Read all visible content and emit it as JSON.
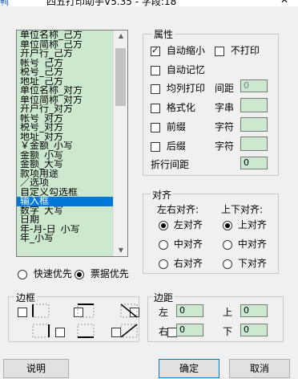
{
  "window": {
    "title": "四五打印助手V5.35 - 字段:18",
    "close_glyph": "✕",
    "icon_glyph": "鸭"
  },
  "list": {
    "items": [
      "单位名称_己方",
      "单位简称_己方",
      "开户行_己方",
      "帐号_己方",
      "税号_己方",
      "地址_己方",
      "单位名称_对方",
      "单位简称_对方",
      "开户行_对方",
      "帐号_对方",
      "税号_对方",
      "地址_对方",
      "￥金额_小写",
      "金额_小写",
      "金额_大写",
      "款项用途",
      "／选项",
      "自定义勾选框",
      "输入框",
      "数字_大写",
      "日期",
      "年-月-日_小写",
      "年_小写"
    ],
    "selected_index": 18
  },
  "priority": {
    "fast_label": "快速优先",
    "receipt_label": "票据优先",
    "selected": "receipt"
  },
  "properties": {
    "title": "属性",
    "auto_shrink_label": "自动缩小",
    "auto_shrink_checked": true,
    "no_print_label": "不打印",
    "no_print_checked": false,
    "auto_remember_label": "自动记忆",
    "auto_remember_checked": false,
    "even_print_label": "均列打印",
    "even_print_checked": false,
    "spacing_label": "间距",
    "spacing_value": "0",
    "format_label": "格式化",
    "format_checked": false,
    "string_label": "字串",
    "string_value": "",
    "prefix_label": "前缀",
    "prefix_checked": false,
    "prefix_char_label": "字符",
    "prefix_char_value": "",
    "suffix_label": "后缀",
    "suffix_checked": false,
    "suffix_char_label": "字符",
    "suffix_char_value": "",
    "line_spacing_label": "折行间距",
    "line_spacing_value": "0"
  },
  "align": {
    "title": "对齐",
    "horizontal_title": "左右对齐:",
    "vertical_title": "上下对齐:",
    "left_label": "左对齐",
    "hcenter_label": "中对齐",
    "right_label": "右对齐",
    "top_label": "上对齐",
    "vcenter_label": "中对齐",
    "bottom_label": "下对齐",
    "horizontal_selected": "left",
    "vertical_selected": "top"
  },
  "border": {
    "title": "边框"
  },
  "margin": {
    "title": "边距",
    "left_label": "左",
    "left_value": "0",
    "top_label": "上",
    "top_value": "0",
    "right_label": "右",
    "right_value": "0",
    "bottom_label": "下",
    "bottom_value": "0"
  },
  "buttons": {
    "help": "说明",
    "ok": "确定",
    "cancel": "取消"
  },
  "colors": {
    "field_bg": "#cce8cf",
    "selection": "#0078d7",
    "dialog_bg": "#f0f0f0"
  }
}
